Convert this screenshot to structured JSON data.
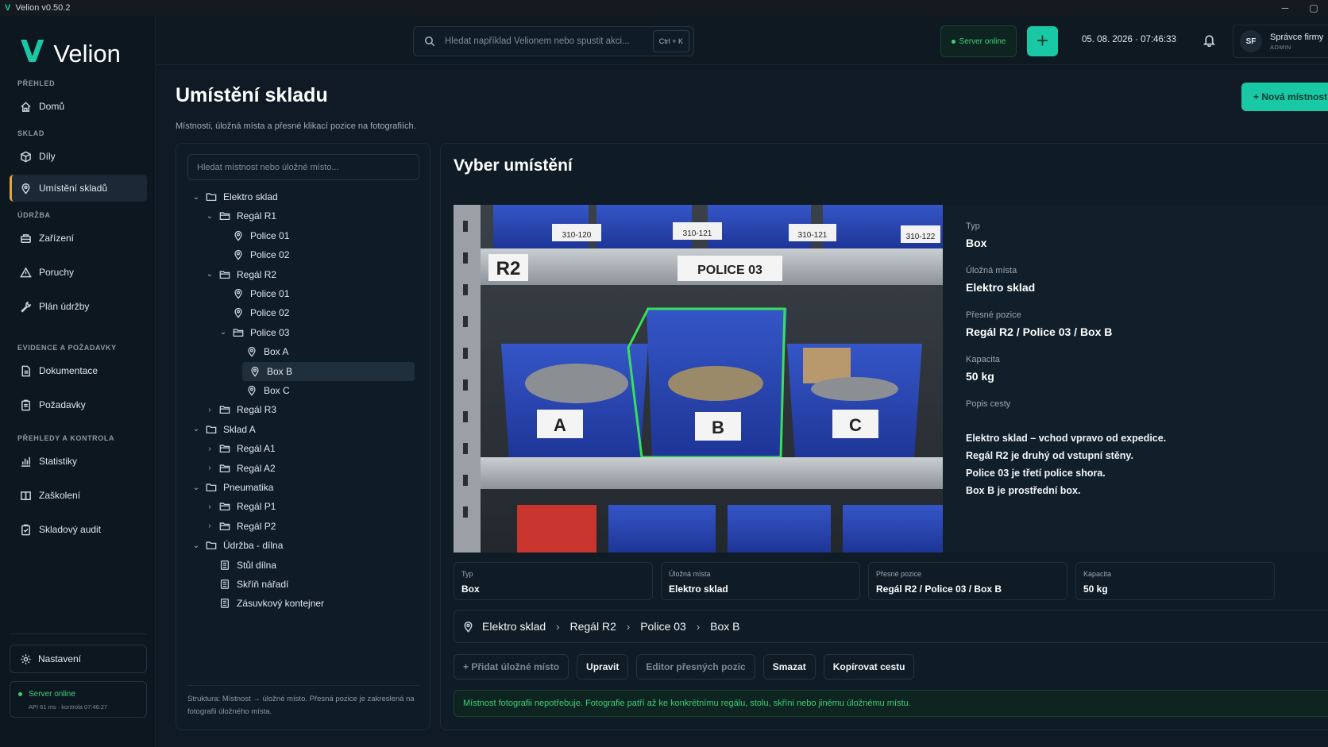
{
  "window": {
    "title": "Velion v0.50.2",
    "minimize": "─",
    "maximize": "▢"
  },
  "brand": {
    "name": "Velion"
  },
  "nav": {
    "sections": [
      {
        "label": "PŘEHLED",
        "items": [
          {
            "label": "Domů",
            "icon": "home-icon"
          }
        ]
      },
      {
        "label": "SKLAD",
        "items": [
          {
            "label": "Díly",
            "icon": "box-icon"
          },
          {
            "label": "Umístění skladů",
            "icon": "location-pin-icon",
            "active": true
          }
        ]
      },
      {
        "label": "ÚDRŽBA",
        "items": [
          {
            "label": "Zařízení",
            "icon": "machine-icon"
          },
          {
            "label": "Poruchy",
            "icon": "warning-icon"
          },
          {
            "label": "Plán údržby",
            "icon": "wrench-icon"
          }
        ]
      },
      {
        "label": "EVIDENCE A POŽADAVKY",
        "items": [
          {
            "label": "Dokumentace",
            "icon": "document-icon"
          },
          {
            "label": "Požadavky",
            "icon": "clipboard-icon"
          }
        ]
      },
      {
        "label": "PŘEHLEDY A KONTROLA",
        "items": [
          {
            "label": "Statistiky",
            "icon": "chart-icon"
          },
          {
            "label": "Zaškolení",
            "icon": "book-icon"
          },
          {
            "label": "Skladový audit",
            "icon": "audit-icon"
          }
        ]
      }
    ],
    "settings": "Nastavení",
    "server": {
      "status": "Server online",
      "detail": "API 61 ms · kontrola 07:46:27"
    }
  },
  "topbar": {
    "search_placeholder": "Hledat například Velionem nebo spustit akci...",
    "shortcut": "Ctrl + K",
    "server_status": "Server online",
    "add": "+",
    "datetime": "05. 08. 2026 · 07:46:33",
    "user": {
      "initials": "SF",
      "name": "Správce firmy",
      "role": "ADMIN"
    }
  },
  "page": {
    "title": "Umístění skladu",
    "subtitle": "Místnosti, úložná místa a přesné klikací pozice na fotografiích.",
    "new_room": "+ Nová místnost"
  },
  "tree": {
    "search_placeholder": "Hledat místnost nebo úložné místo...",
    "rows": [
      {
        "label": "Elektro sklad",
        "level": 0,
        "chev": "⌄",
        "icon": "folder-icon"
      },
      {
        "label": "Regál R1",
        "level": 1,
        "chev": "⌄",
        "icon": "folder-open-icon"
      },
      {
        "label": "Police 01",
        "level": 2,
        "chev": "",
        "icon": "pin-icon"
      },
      {
        "label": "Police 02",
        "level": 2,
        "chev": "",
        "icon": "pin-icon"
      },
      {
        "label": "Regál R2",
        "level": 1,
        "chev": "⌄",
        "icon": "folder-open-icon"
      },
      {
        "label": "Police 01",
        "level": 2,
        "chev": "",
        "icon": "pin-icon"
      },
      {
        "label": "Police 02",
        "level": 2,
        "chev": "",
        "icon": "pin-icon"
      },
      {
        "label": "Police 03",
        "level": 2,
        "chev": "⌄",
        "icon": "folder-open-icon",
        "chev_left": true
      },
      {
        "label": "Box A",
        "level": 3,
        "chev": "",
        "icon": "pin-icon"
      },
      {
        "label": "Box B",
        "level": 3,
        "chev": "",
        "icon": "pin-icon",
        "selected": true
      },
      {
        "label": "Box C",
        "level": 3,
        "chev": "",
        "icon": "pin-icon"
      },
      {
        "label": "Regál R3",
        "level": 1,
        "chev": "›",
        "icon": "folder-open-icon"
      },
      {
        "label": "Sklad A",
        "level": 0,
        "chev": "⌄",
        "icon": "folder-icon"
      },
      {
        "label": "Regál A1",
        "level": 1,
        "chev": "›",
        "icon": "folder-open-icon"
      },
      {
        "label": "Regál A2",
        "level": 1,
        "chev": "›",
        "icon": "folder-open-icon"
      },
      {
        "label": "Pneumatika",
        "level": 0,
        "chev": "⌄",
        "icon": "folder-icon"
      },
      {
        "label": "Regál P1",
        "level": 1,
        "chev": "›",
        "icon": "folder-open-icon"
      },
      {
        "label": "Regál P2",
        "level": 1,
        "chev": "›",
        "icon": "folder-open-icon"
      },
      {
        "label": "Údržba - dílna",
        "level": 0,
        "chev": "⌄",
        "icon": "folder-icon"
      },
      {
        "label": "Stůl dílna",
        "level": 1,
        "chev": "",
        "icon": "cabinet-icon"
      },
      {
        "label": "Skříň nářadí",
        "level": 1,
        "chev": "",
        "icon": "cabinet-icon"
      },
      {
        "label": "Zásuvkový kontejner",
        "level": 1,
        "chev": "",
        "icon": "cabinet-icon"
      }
    ],
    "footer": "Struktura: Místnost → úložné místo. Přesná pozice je zakreslená na fotografii úložného místa."
  },
  "detail": {
    "title": "Vyber umístění",
    "photo": {
      "rack": "R2",
      "shelf": "POLICE 03",
      "boxes": [
        "A",
        "B",
        "C"
      ],
      "bin_labels": [
        "310-120",
        "310-121",
        "310-121",
        "310-122"
      ]
    },
    "info": [
      {
        "label": "Typ",
        "value": "Box"
      },
      {
        "label": "Úložná místa",
        "value": "Elektro sklad"
      },
      {
        "label": "Přesné pozice",
        "value": "Regál R2 / Police 03 / Box B"
      },
      {
        "label": "Kapacita",
        "value": "50 kg"
      }
    ],
    "description_label": "Popis cesty",
    "description": [
      "Elektro sklad – vchod vpravo od expedice.",
      "Regál R2 je druhý od vstupní stěny.",
      "Police 03 je třetí police shora.",
      "Box B je prostřední box."
    ],
    "cards": [
      {
        "label": "Typ",
        "value": "Box"
      },
      {
        "label": "Úložná místa",
        "value": "Elektro sklad"
      },
      {
        "label": "Přesné pozice",
        "value": "Regál R2 / Police 03 / Box B"
      },
      {
        "label": "Kapacita",
        "value": "50 kg"
      }
    ],
    "path": [
      "Elektro sklad",
      "Regál R2",
      "Police 03",
      "Box B"
    ],
    "actions": [
      {
        "label": "+ Přidat úložné místo",
        "disabled": true
      },
      {
        "label": "Upravit",
        "disabled": false
      },
      {
        "label": "Editor přesných pozic",
        "disabled": true
      },
      {
        "label": "Smazat",
        "disabled": false
      },
      {
        "label": "Kopírovat cestu",
        "disabled": false
      }
    ],
    "note": "Místnost fotografii nepotřebuje. Fotografie patří až ke konkrétnímu regálu, stolu, skříni nebo jinému úložnému místu."
  }
}
